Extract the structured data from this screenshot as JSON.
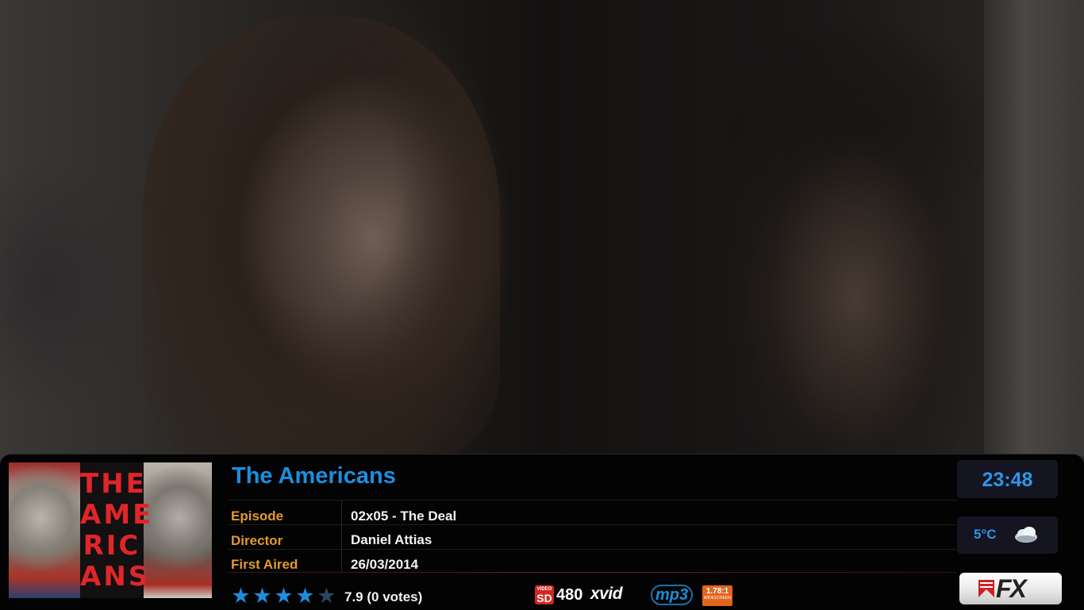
{
  "background": {
    "description_icon": "video-frame"
  },
  "poster": {
    "title_lines": [
      "THE",
      "AME",
      "RIC",
      "ANS"
    ]
  },
  "show": {
    "title": "The Americans"
  },
  "details": [
    {
      "label": "Episode",
      "value": "02x05 - The Deal"
    },
    {
      "label": "Director",
      "value": "Daniel Attias"
    },
    {
      "label": "First Aired",
      "value": "26/03/2014"
    }
  ],
  "rating": {
    "stars_filled": 4,
    "stars_total": 5,
    "text": "7.9 (0 votes)"
  },
  "media_flags": {
    "video_label": "VIDEO",
    "video_def": "SD",
    "resolution": "480",
    "codec": "xvid",
    "audio": "mp3",
    "aspect": "1.78:1",
    "aspect_sub": "WIDESCREEN"
  },
  "clock": {
    "time": "23:48"
  },
  "weather": {
    "temp": "5°C",
    "icon": "cloud-icon"
  },
  "network": {
    "name": "FX"
  },
  "colors": {
    "accent": "#1a8fe0",
    "label": "#e39a2b",
    "panel": "#030303"
  }
}
